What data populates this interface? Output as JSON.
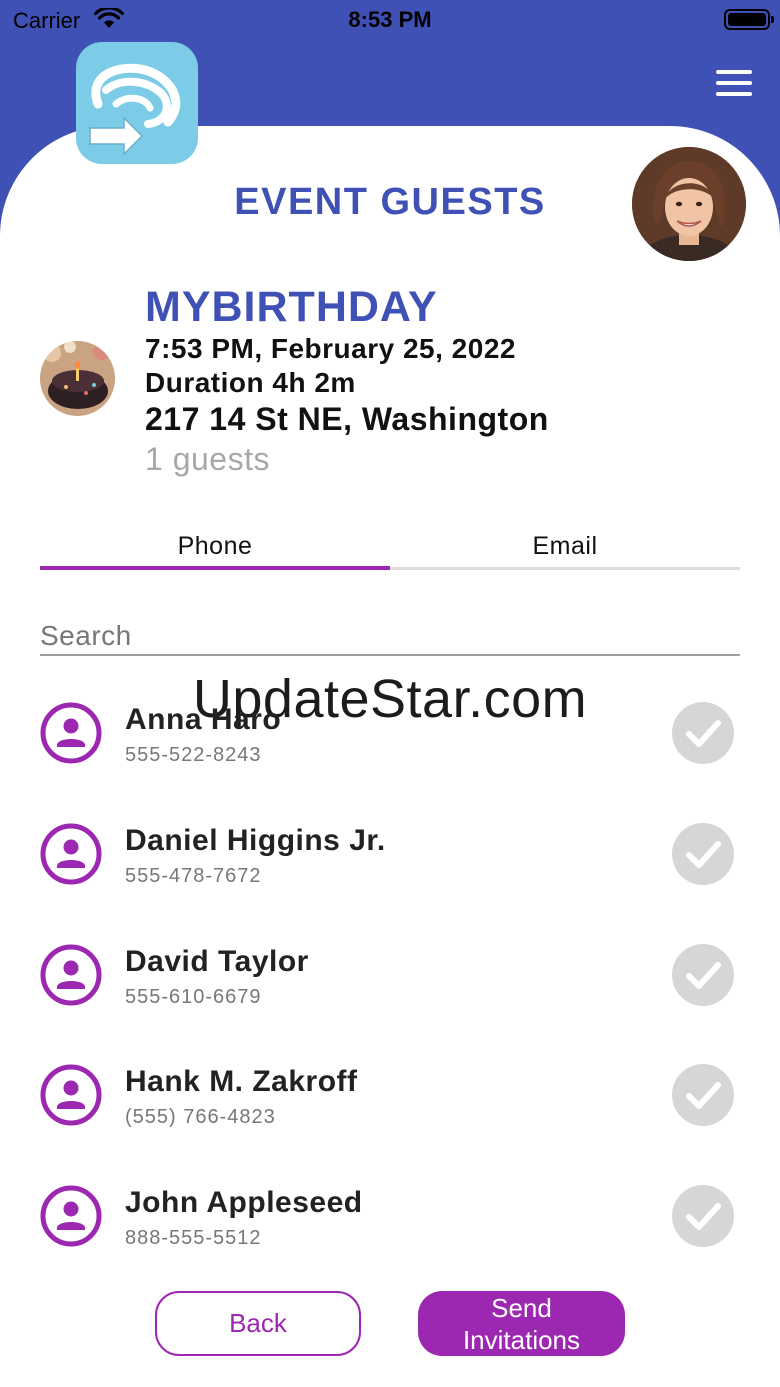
{
  "status_bar": {
    "carrier": "Carrier",
    "time": "8:53 PM"
  },
  "header": {
    "title": "EVENT GUESTS",
    "logo_icon": "app-logo-icon",
    "menu_icon": "hamburger-menu-icon",
    "accent_color": "#3f51b5"
  },
  "event": {
    "name": "MYBIRTHDAY",
    "datetime": "7:53 PM, February 25, 2022",
    "duration": "Duration 4h 2m",
    "address": "217 14 St NE, Washington",
    "guests": "1 guests"
  },
  "tabs": [
    {
      "label": "Phone",
      "active": true
    },
    {
      "label": "Email",
      "active": false
    }
  ],
  "search": {
    "placeholder": "Search",
    "value": ""
  },
  "watermark": "UpdateStar.com",
  "contacts": [
    {
      "name": "Anna Haro",
      "phone": "555-522-8243",
      "selected": false
    },
    {
      "name": "Daniel Higgins Jr.",
      "phone": "555-478-7672",
      "selected": false
    },
    {
      "name": "David Taylor",
      "phone": "555-610-6679",
      "selected": false
    },
    {
      "name": "Hank M. Zakroff",
      "phone": "(555) 766-4823",
      "selected": false
    },
    {
      "name": "John Appleseed",
      "phone": "888-555-5512",
      "selected": false
    }
  ],
  "buttons": {
    "back": "Back",
    "send_line1": "Send",
    "send_line2": "Invitations"
  },
  "colors": {
    "primary": "#3f51b5",
    "accent": "#9c27b0",
    "check_inactive": "#d6d6d6"
  }
}
